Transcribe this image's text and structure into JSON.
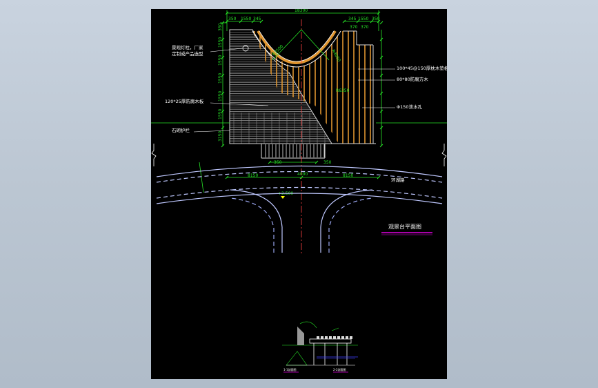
{
  "window": {
    "background_color": "#c4ceda",
    "viewport_color": "#000000"
  },
  "colors": {
    "dimension": "#27e627",
    "text": "#ffffff",
    "wood": "#e0952f",
    "road": "#bfc8ff",
    "centerline": "#ff4040",
    "title_underline": "#e000e0"
  },
  "drawing": {
    "title": "观景台平面图",
    "dims": {
      "overall": "18300",
      "top_left": [
        "350",
        "1550",
        "345"
      ],
      "top_right": [
        "345",
        "1550",
        "350"
      ],
      "left_col": [
        "350",
        "1550",
        "1550",
        "1550",
        "1550",
        "1550",
        "3150"
      ],
      "right_col_top": [
        "370",
        "370"
      ],
      "arc": "R2500",
      "arc_right": "R4050",
      "inner": "R6350",
      "bottom_left": "350",
      "bottom_right": "350",
      "road_left": "8150",
      "road_mid": "4000",
      "road_right": "8150",
      "elevation": "+2.500"
    },
    "labels": {
      "lamp": "景观灯柱，厂家",
      "lamp2": "定制或产品选型",
      "board_left": "120*25厚防腐木板",
      "wall": "石砌护栏",
      "deck_right": "100*45@150厚枕木垫板",
      "wood_square": "80*80防腐方木",
      "drain": "Φ150泄水孔",
      "road": "环湖路"
    },
    "section_labels": [
      "1-1剖面图",
      "2-2剖面图"
    ]
  }
}
